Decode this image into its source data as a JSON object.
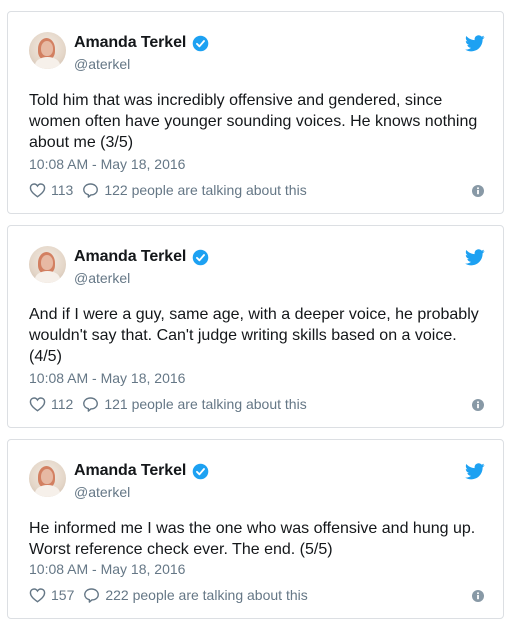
{
  "colors": {
    "twitter_blue": "#1da1f2",
    "text_primary": "#14171a",
    "text_secondary": "#657786",
    "border": "#dcdfe3"
  },
  "tweets": [
    {
      "display_name": "Amanda Terkel",
      "handle": "@aterkel",
      "text": "Told him that was incredibly offensive and gendered, since women often have younger sounding voices. He knows nothing about me (3/5)",
      "timestamp": "10:08 AM - May 18, 2016",
      "likes": "113",
      "talking": "122 people are talking about this"
    },
    {
      "display_name": "Amanda Terkel",
      "handle": "@aterkel",
      "text": "And if I were a guy, same age, with a deeper voice, he probably wouldn't say that. Can't judge writing skills based on a voice. (4/5)",
      "timestamp": "10:08 AM - May 18, 2016",
      "likes": "112",
      "talking": "121 people are talking about this"
    },
    {
      "display_name": "Amanda Terkel",
      "handle": "@aterkel",
      "text": "He informed me I was the one who was offensive and hung up. Worst reference check ever. The end. (5/5)",
      "timestamp": "10:08 AM - May 18, 2016",
      "likes": "157",
      "talking": "222 people are talking about this"
    }
  ]
}
